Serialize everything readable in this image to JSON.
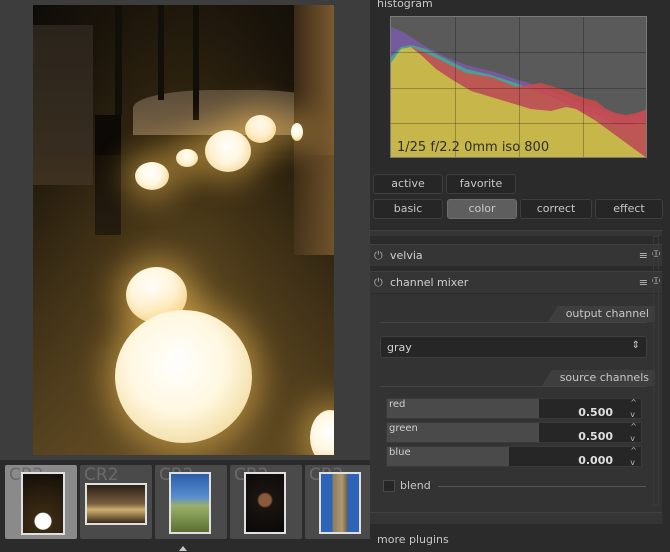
{
  "histogram": {
    "title": "histogram",
    "exif": "1/25 f/2.2 0mm iso 800"
  },
  "module_groups": {
    "row1": [
      "active",
      "favorite"
    ],
    "row2": [
      "basic",
      "color",
      "correct",
      "effect"
    ],
    "selected": "color"
  },
  "modules": {
    "velvia": {
      "name": "velvia",
      "menu_icon": "≡",
      "reset_icon": "⏼"
    },
    "channel_mixer": {
      "name": "channel mixer",
      "menu_icon": "≡",
      "reset_icon": "⏼"
    }
  },
  "channel_mixer": {
    "output_channel_label": "output channel",
    "output_channel_value": "gray",
    "source_channels_label": "source channels",
    "sliders": [
      {
        "label": "red",
        "value": "0.500",
        "level": 0.6
      },
      {
        "label": "green",
        "value": "0.500",
        "level": 0.6
      },
      {
        "label": "blue",
        "value": "0.000",
        "level": 0.48
      }
    ],
    "blend_label": "blend"
  },
  "filmstrip": {
    "extensions": [
      "CR2",
      "CR2",
      "CR2",
      "CR2",
      "CR2"
    ]
  },
  "more_plugins": "more plugins"
}
